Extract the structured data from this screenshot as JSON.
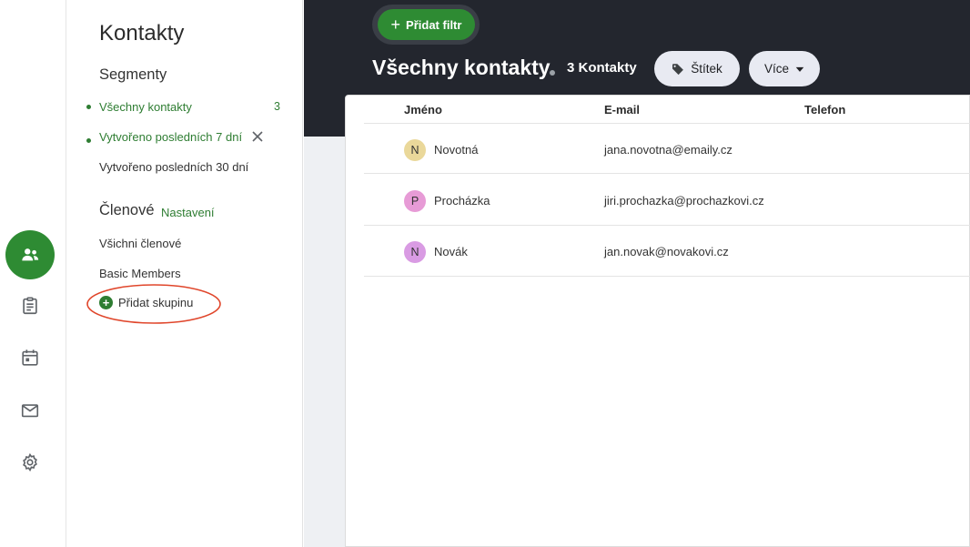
{
  "rail": {
    "items": [
      {
        "icon": "contacts-icon",
        "active": true
      },
      {
        "icon": "clipboard-icon",
        "active": false
      },
      {
        "icon": "calendar-icon",
        "active": false
      },
      {
        "icon": "mail-icon",
        "active": false
      },
      {
        "icon": "gear-icon",
        "active": false
      }
    ]
  },
  "sidebar": {
    "title": "Kontakty",
    "segments_heading": "Segmenty",
    "segments": [
      {
        "label": "Všechny kontakty",
        "count": "3",
        "active": true
      },
      {
        "label": "Vytvořeno posledních 7 dní",
        "active": true,
        "removable": true
      },
      {
        "label": "Vytvořeno posledních 30 dní",
        "active": false
      }
    ],
    "members_heading": "Členové",
    "members_settings": "Nastavení",
    "groups": [
      {
        "label": "Všichni členové"
      },
      {
        "label": "Basic Members"
      }
    ],
    "add_group": "Přidat skupinu"
  },
  "header": {
    "add_filter": "Přidat filtr",
    "title": "Všechny kontakty",
    "count": "3 Kontakty",
    "tag_button": "Štítek",
    "more_button": "Více"
  },
  "table": {
    "columns": [
      "Jméno",
      "E-mail",
      "Telefon"
    ],
    "rows": [
      {
        "initial": "N",
        "name": "Novotná",
        "email": "jana.novotna@emaily.cz",
        "phone": "",
        "avatar_color": "#ead89a"
      },
      {
        "initial": "P",
        "name": "Procházka",
        "email": "jiri.prochazka@prochazkovi.cz",
        "phone": "",
        "avatar_color": "#e79bd6"
      },
      {
        "initial": "N",
        "name": "Novák",
        "email": "jan.novak@novakovi.cz",
        "phone": "",
        "avatar_color": "#d99be3"
      }
    ]
  },
  "colors": {
    "accent": "#2e8b33",
    "header_bg": "#23262e",
    "annotation": "#e0462b"
  }
}
